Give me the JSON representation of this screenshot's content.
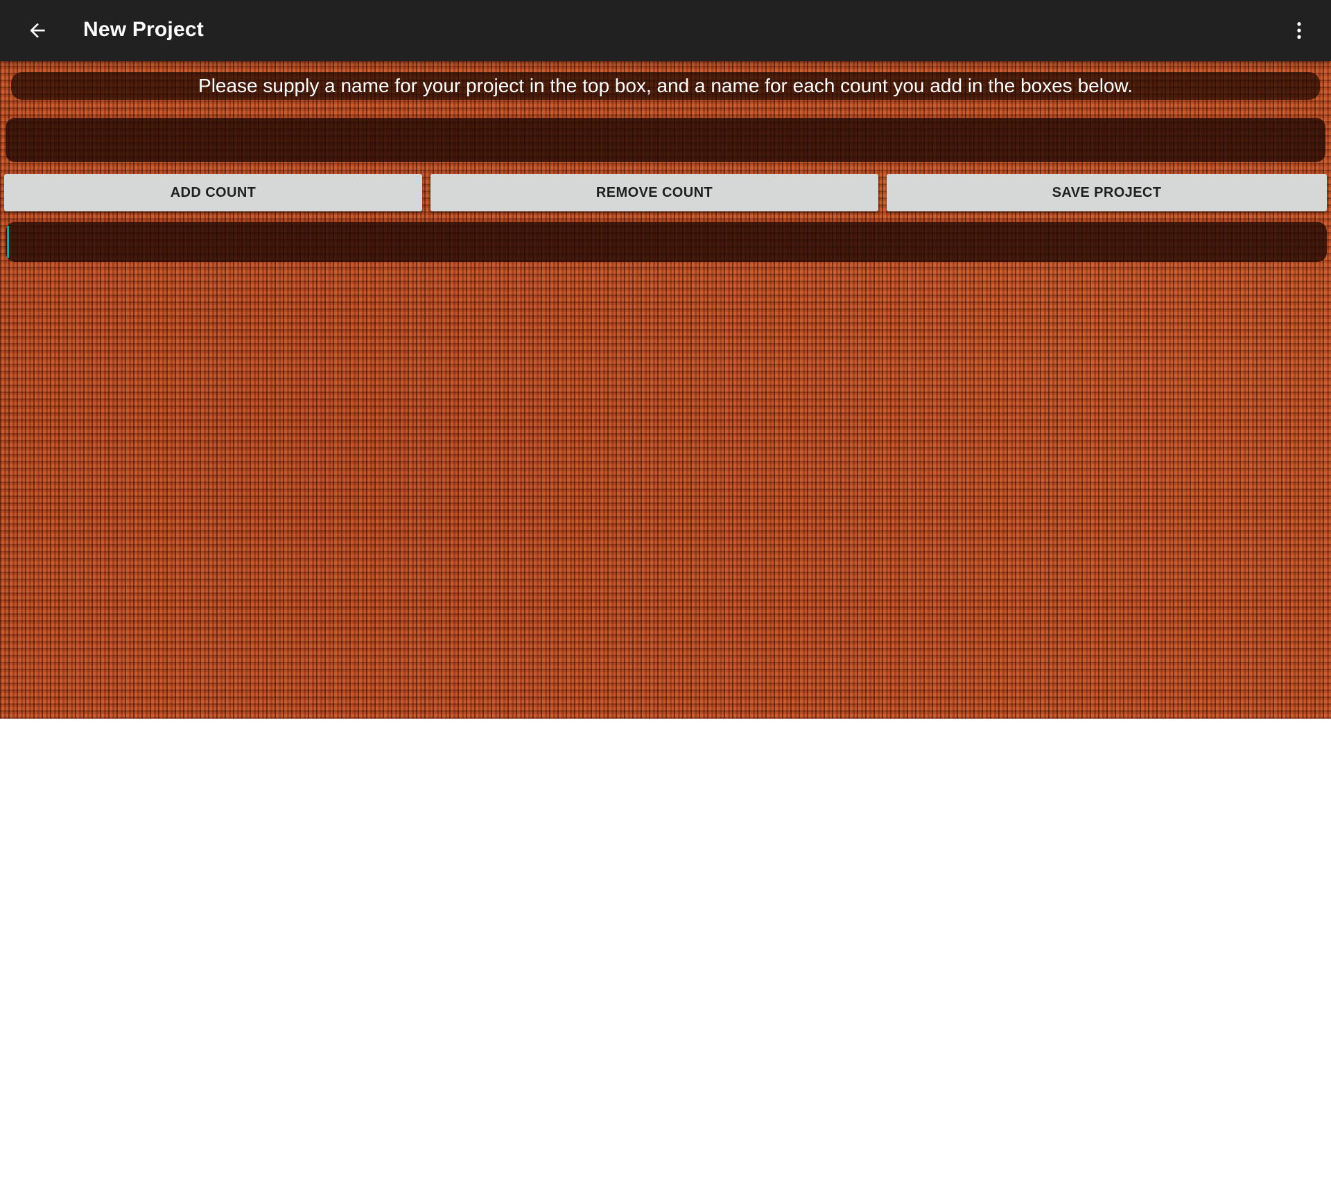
{
  "appbar": {
    "title": "New Project",
    "back_icon": "arrow-left-icon",
    "menu_icon": "more-vert-icon",
    "background": "#212121"
  },
  "main": {
    "instructions": "Please supply a name for your project in the top box, and a name for each count you add in the boxes below.",
    "project_name": {
      "value": "",
      "placeholder": ""
    },
    "buttons": {
      "add_count": "ADD COUNT",
      "remove_count": "REMOVE COUNT",
      "save_project": "SAVE PROJECT"
    },
    "count_names": [
      {
        "value": "",
        "placeholder": ""
      }
    ],
    "accent_color": "#1aa39a",
    "button_color": "#d6d7d7",
    "background_texture": "orange-knit-fabric"
  }
}
